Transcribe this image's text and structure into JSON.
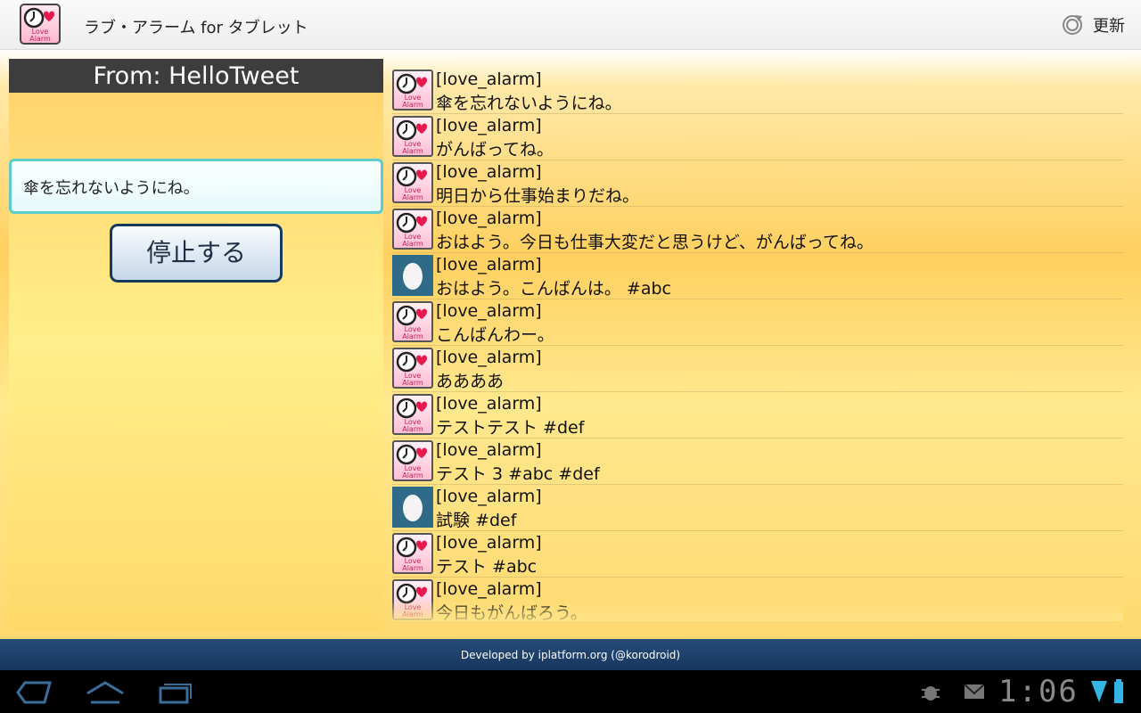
{
  "app": {
    "title": "ラブ・アラーム for タブレット",
    "refresh_label": "更新",
    "icon": "love-alarm-icon",
    "refresh_icon": "refresh-icon"
  },
  "left": {
    "from": "From: HelloTweet",
    "message": "傘を忘れないようにね。",
    "stop_label": "停止する"
  },
  "timeline": [
    {
      "user": "[love_alarm]",
      "text": "傘を忘れないようにね。",
      "avatar": "love"
    },
    {
      "user": "[love_alarm]",
      "text": "がんばってね。",
      "avatar": "love"
    },
    {
      "user": "[love_alarm]",
      "text": "明日から仕事始まりだね。",
      "avatar": "love"
    },
    {
      "user": "[love_alarm]",
      "text": "おはよう。今日も仕事大変だと思うけど、がんばってね。",
      "avatar": "love"
    },
    {
      "user": "[love_alarm]",
      "text": "おはよう。こんばんは。 #abc",
      "avatar": "egg"
    },
    {
      "user": "[love_alarm]",
      "text": "こんばんわー。",
      "avatar": "love"
    },
    {
      "user": "[love_alarm]",
      "text": "ああああ",
      "avatar": "love"
    },
    {
      "user": "[love_alarm]",
      "text": "テストテスト #def",
      "avatar": "love"
    },
    {
      "user": "[love_alarm]",
      "text": "テスト 3  #abc #def",
      "avatar": "love"
    },
    {
      "user": "[love_alarm]",
      "text": "試験 #def",
      "avatar": "egg"
    },
    {
      "user": "[love_alarm]",
      "text": "テスト #abc",
      "avatar": "love"
    },
    {
      "user": "[love_alarm]",
      "text": "今日もがんばろう。",
      "avatar": "love"
    }
  ],
  "footer": {
    "text": "Developed by iplatform.org (@korodroid)"
  },
  "system": {
    "time": "1:06"
  },
  "colors": {
    "accent_pink": "#e8174e",
    "footer_blue": "#1f4170",
    "header_gray": "#3d3d3d",
    "input_border": "#5ccccc"
  }
}
